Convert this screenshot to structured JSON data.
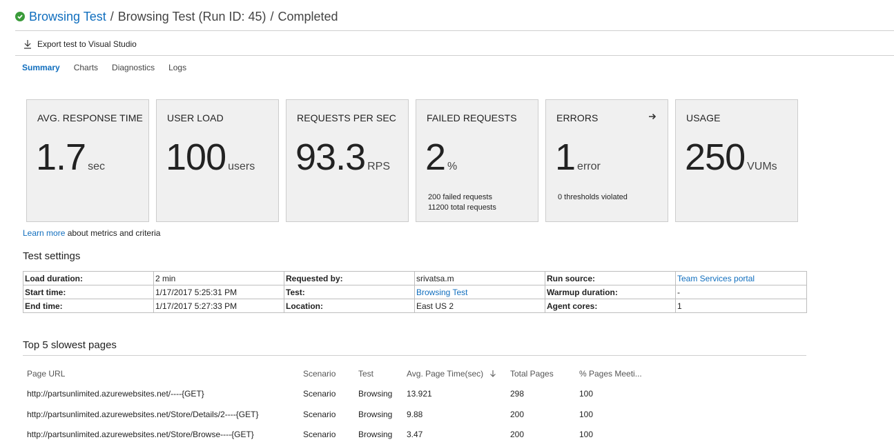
{
  "header": {
    "test_link": "Browsing Test",
    "separator": "/",
    "run": "Browsing Test (Run ID: 45)",
    "status": "Completed"
  },
  "toolbar": {
    "export_label": "Export test to Visual Studio"
  },
  "tabs": [
    {
      "label": "Summary",
      "active": true
    },
    {
      "label": "Charts"
    },
    {
      "label": "Diagnostics"
    },
    {
      "label": "Logs"
    }
  ],
  "tiles": [
    {
      "title": "AVG. RESPONSE TIME",
      "value": "1.7",
      "unit": "sec"
    },
    {
      "title": "USER LOAD",
      "value": "100",
      "unit": "users"
    },
    {
      "title": "REQUESTS PER SEC",
      "value": "93.3",
      "unit": "RPS"
    },
    {
      "title": "FAILED REQUESTS",
      "value": "2",
      "unit": "%",
      "note1": "200 failed requests",
      "note2": "11200 total requests"
    },
    {
      "title": "ERRORS",
      "value": "1",
      "unit": "error",
      "note1": "0 thresholds violated"
    },
    {
      "title": "USAGE",
      "value": "250",
      "unit": "VUMs"
    }
  ],
  "learn": {
    "link": "Learn more",
    "rest": " about metrics and criteria"
  },
  "settings": {
    "title": "Test settings",
    "rows": [
      [
        "Load duration:",
        "2 min",
        "Requested by:",
        "srivatsa.m",
        "Run source:",
        "Team Services portal"
      ],
      [
        "Start time:",
        "1/17/2017 5:25:31 PM",
        "Test:",
        "Browsing Test",
        "Warmup duration:",
        "-"
      ],
      [
        "End time:",
        "1/17/2017 5:27:33 PM",
        "Location:",
        "East US 2",
        "Agent cores:",
        "1"
      ]
    ]
  },
  "slowest": {
    "title": "Top 5 slowest pages",
    "headers": [
      "Page URL",
      "Scenario",
      "Test",
      "Avg. Page Time(sec)",
      "Total Pages",
      "% Pages Meeti..."
    ],
    "rows": [
      [
        "http://partsunlimited.azurewebsites.net/----{GET}",
        "Scenario",
        "Browsing",
        "13.921",
        "298",
        "100"
      ],
      [
        "http://partsunlimited.azurewebsites.net/Store/Details/2----{GET}",
        "Scenario",
        "Browsing",
        "9.88",
        "200",
        "100"
      ],
      [
        "http://partsunlimited.azurewebsites.net/Store/Browse----{GET}",
        "Scenario",
        "Browsing",
        "3.47",
        "200",
        "100"
      ]
    ]
  },
  "colors": {
    "link": "#106ebe",
    "success": "#3a9b3a",
    "tile_bg": "#f0f0f0"
  }
}
